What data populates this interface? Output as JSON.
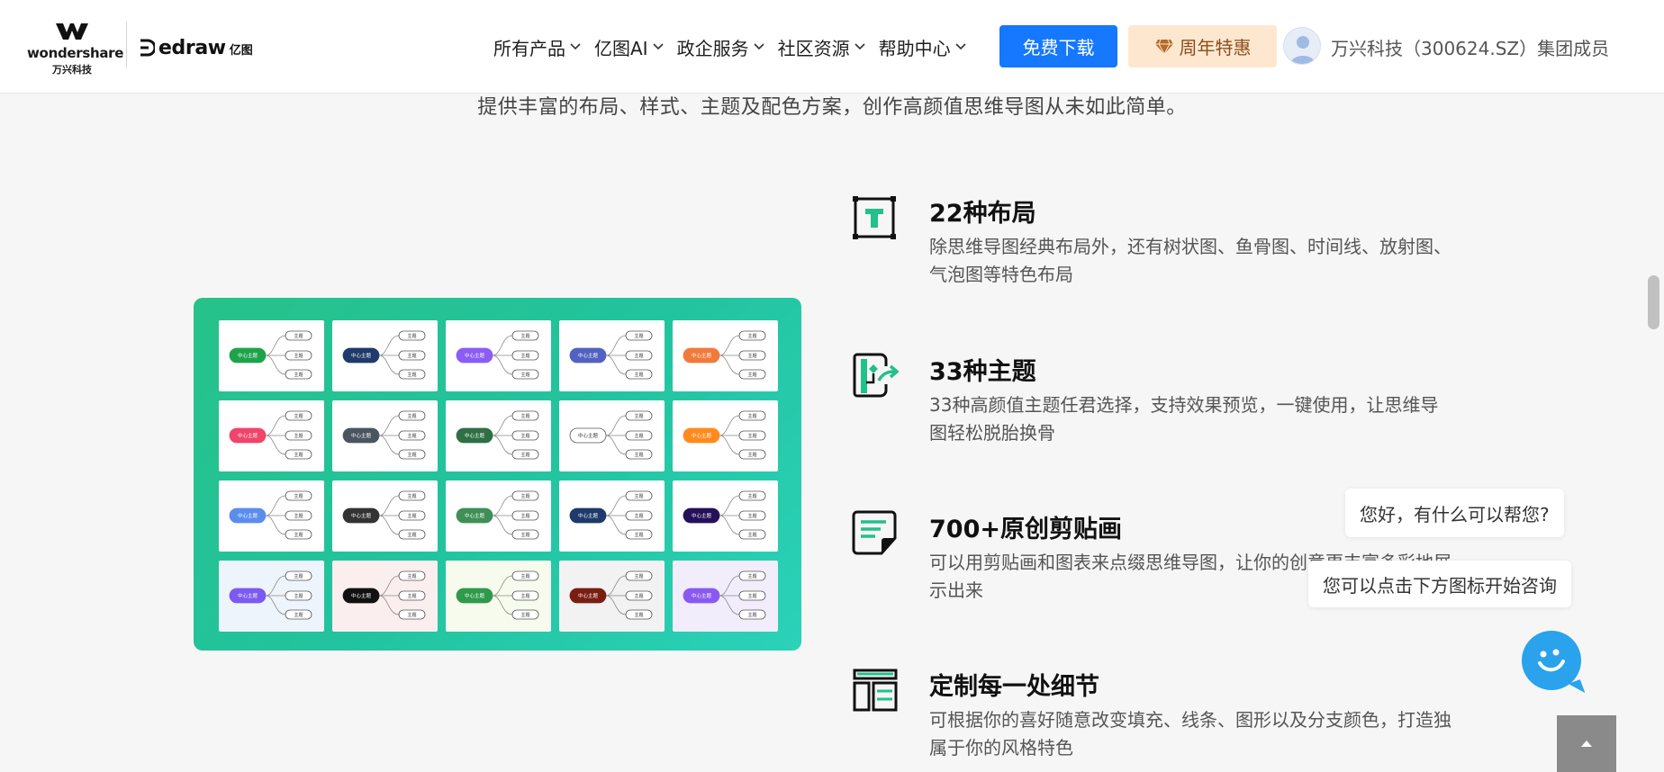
{
  "header": {
    "brand": {
      "wordmark": "wondershare",
      "wordmark_cn": "万兴科技",
      "product_word": "edraw",
      "product_cn": "亿图"
    },
    "nav": [
      {
        "label": "所有产品",
        "has_dropdown": true
      },
      {
        "label": "亿图AI",
        "has_dropdown": true
      },
      {
        "label": "政企服务",
        "has_dropdown": true
      },
      {
        "label": "社区资源",
        "has_dropdown": true
      },
      {
        "label": "帮助中心",
        "has_dropdown": true
      }
    ],
    "download_label": "免费下载",
    "promo_label": "周年特惠",
    "company_text": "万兴科技（300624.SZ）集团成员"
  },
  "subtitle": "提供丰富的布局、样式、主题及配色方案，创作高颜值思维导图从未如此简单。",
  "showcase": {
    "center_label": "中心主题",
    "branch_label": "主题",
    "cards": [
      {
        "bg": "#ffffff",
        "accent": "#1fa34a",
        "text_color": "#ffffff"
      },
      {
        "bg": "#ffffff",
        "accent": "#1f3a6b",
        "text_color": "#ffffff"
      },
      {
        "bg": "#ffffff",
        "accent": "#8b5cf6",
        "text_color": "#ffffff"
      },
      {
        "bg": "#ffffff",
        "accent": "#5162c0",
        "text_color": "#ffffff"
      },
      {
        "bg": "#ffffff",
        "accent": "#f07a3b",
        "text_color": "#ffffff"
      },
      {
        "bg": "#ffffff",
        "accent": "#f0446a",
        "text_color": "#ffffff"
      },
      {
        "bg": "#ffffff",
        "accent": "#4a5560",
        "text_color": "#ffffff"
      },
      {
        "bg": "#ffffff",
        "accent": "#2f6f45",
        "text_color": "#ffffff"
      },
      {
        "bg": "#ffffff",
        "accent": "#ffffff",
        "text_color": "#333333"
      },
      {
        "bg": "#ffffff",
        "accent": "#ff8a1e",
        "text_color": "#ffffff"
      },
      {
        "bg": "#ffffff",
        "accent": "#5b8def",
        "text_color": "#ffffff"
      },
      {
        "bg": "#ffffff",
        "accent": "#333333",
        "text_color": "#ffffff"
      },
      {
        "bg": "#ffffff",
        "accent": "#3f8f56",
        "text_color": "#ffffff"
      },
      {
        "bg": "#ffffff",
        "accent": "#1f3a6b",
        "text_color": "#ffffff"
      },
      {
        "bg": "#ffffff",
        "accent": "#25105a",
        "text_color": "#ffffff"
      },
      {
        "bg": "#eef4fb",
        "accent": "#7a5af0",
        "text_color": "#ffffff"
      },
      {
        "bg": "#fbeeee",
        "accent": "#111111",
        "text_color": "#ffffff"
      },
      {
        "bg": "#f7fbee",
        "accent": "#2f9a4a",
        "text_color": "#ffffff"
      },
      {
        "bg": "#f2f2f2",
        "accent": "#7a1e12",
        "text_color": "#ffffff"
      },
      {
        "bg": "#f1edfb",
        "accent": "#8a5af0",
        "text_color": "#ffffff"
      }
    ]
  },
  "features": [
    {
      "icon": "text-frame-icon",
      "title": "22种布局",
      "desc": "除思维导图经典布局外，还有树状图、鱼骨图、时间线、放射图、气泡图等特色布局"
    },
    {
      "icon": "theme-share-icon",
      "title": "33种主题",
      "desc": "33种高颜值主题任君选择，支持效果预览，一键使用，让思维导图轻松脱胎换骨"
    },
    {
      "icon": "clipart-note-icon",
      "title": "700+原创剪贴画",
      "desc": "可以用剪贴画和图表来点缀思维导图，让你的创意更丰富多彩地展示出来"
    },
    {
      "icon": "layout-panel-icon",
      "title": "定制每一处细节",
      "desc": "可根据你的喜好随意改变填充、线条、图形以及分支颜色，打造独属于你的风格特色"
    }
  ],
  "chat": {
    "greeting": "您好，有什么可以帮您?",
    "hint": "您可以点击下方图标开始咨询"
  },
  "colors": {
    "primary": "#1677ff",
    "promo_bg": "#fde8cf",
    "accent_green": "#27c28a",
    "chat_blue": "#2aa3ec"
  }
}
